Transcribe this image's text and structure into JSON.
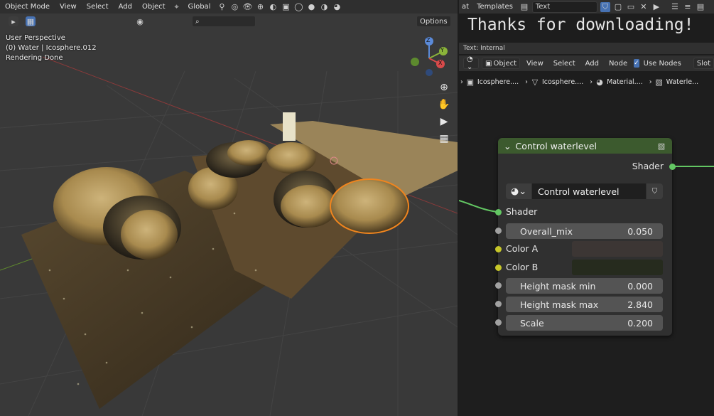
{
  "viewport": {
    "mode_label": "Object Mode",
    "menu": [
      "View",
      "Select",
      "Add",
      "Object"
    ],
    "transform_orientation": "Global",
    "options_label": "Options",
    "overlay": {
      "perspective": "User Perspective",
      "collection": "(0) Water | Icosphere.012",
      "status": "Rendering Done"
    },
    "gizmo": {
      "x": "X",
      "y": "Y",
      "z": "Z"
    }
  },
  "text_editor": {
    "menu_left": "at",
    "templates_label": "Templates",
    "datablock_name": "Text",
    "content": "Thanks for downloading!",
    "footer": "Text: Internal"
  },
  "node_editor": {
    "header": {
      "type_label": "Object",
      "menu": [
        "View",
        "Select",
        "Add",
        "Node"
      ],
      "use_nodes_label": "Use Nodes",
      "slot_label": "Slot"
    },
    "breadcrumb": [
      "Icosphere....",
      "Icosphere....",
      "Material....",
      "Waterle..."
    ],
    "node": {
      "title": "Control waterlevel",
      "output_label": "Shader",
      "group_name": "Control waterlevel",
      "input_shader_label": "Shader",
      "inputs": [
        {
          "label": "Overall_mix",
          "value": "0.050"
        },
        {
          "label": "Height mask min",
          "value": "0.000"
        },
        {
          "label": "Height mask max",
          "value": "2.840"
        },
        {
          "label": "Scale",
          "value": "0.200"
        }
      ],
      "color_a_label": "Color A",
      "color_b_label": "Color B",
      "color_a": "#3c3634",
      "color_b": "#262b1e"
    }
  },
  "colors": {
    "node_header": "#3c5a2e",
    "socket_shader": "#63c763",
    "socket_color": "#c7c729",
    "socket_float": "#a1a1a1",
    "selection_outline": "#f0851e",
    "accent_blue": "#4772b3"
  }
}
